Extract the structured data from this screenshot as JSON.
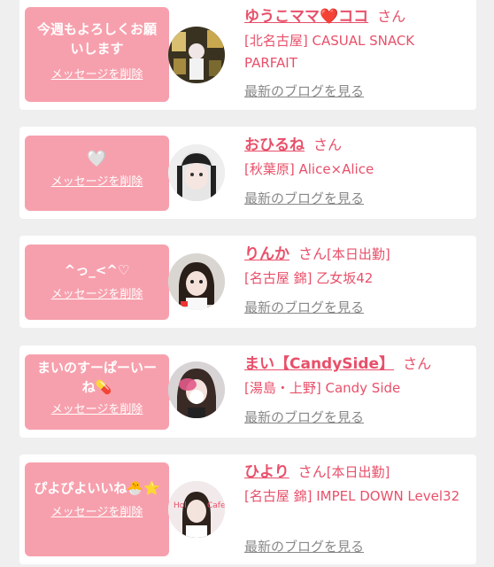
{
  "favorites": [
    {
      "message": "今週もよろしくお願いします",
      "delete_label": "メッセージを削除",
      "name": "ゆうこママ❤️ココ",
      "san": "さん",
      "status": "",
      "shop": "[北名古屋] CASUAL SNACK PARFAIT",
      "blog_label": "最新のブログを見る"
    },
    {
      "message": "🤍",
      "delete_label": "メッセージを削除",
      "name": "おひるね",
      "san": "さん",
      "status": "",
      "shop": "[秋葉原] Alice×Alice",
      "blog_label": "最新のブログを見る"
    },
    {
      "message": "^っ_<^♡",
      "delete_label": "メッセージを削除",
      "name": "りんか",
      "san": "さん",
      "status": "[本日出勤]",
      "shop": "[名古屋 錦] 乙女坂42",
      "blog_label": "最新のブログを見る"
    },
    {
      "message": "まいのすーぱーいーね💊",
      "delete_label": "メッセージを削除",
      "name": "まい【CandySide】",
      "san": "さん",
      "status": "",
      "shop": "[湯島・上野] Candy Side",
      "blog_label": "最新のブログを見る"
    },
    {
      "message": "ぴよぴよいいね🐣⭐️",
      "delete_label": "メッセージを削除",
      "name": "ひより",
      "san": "さん",
      "status": "[本日出勤]",
      "shop": "[名古屋 錦] IMPEL DOWN Level32",
      "blog_label": "最新のブログを見る"
    }
  ]
}
